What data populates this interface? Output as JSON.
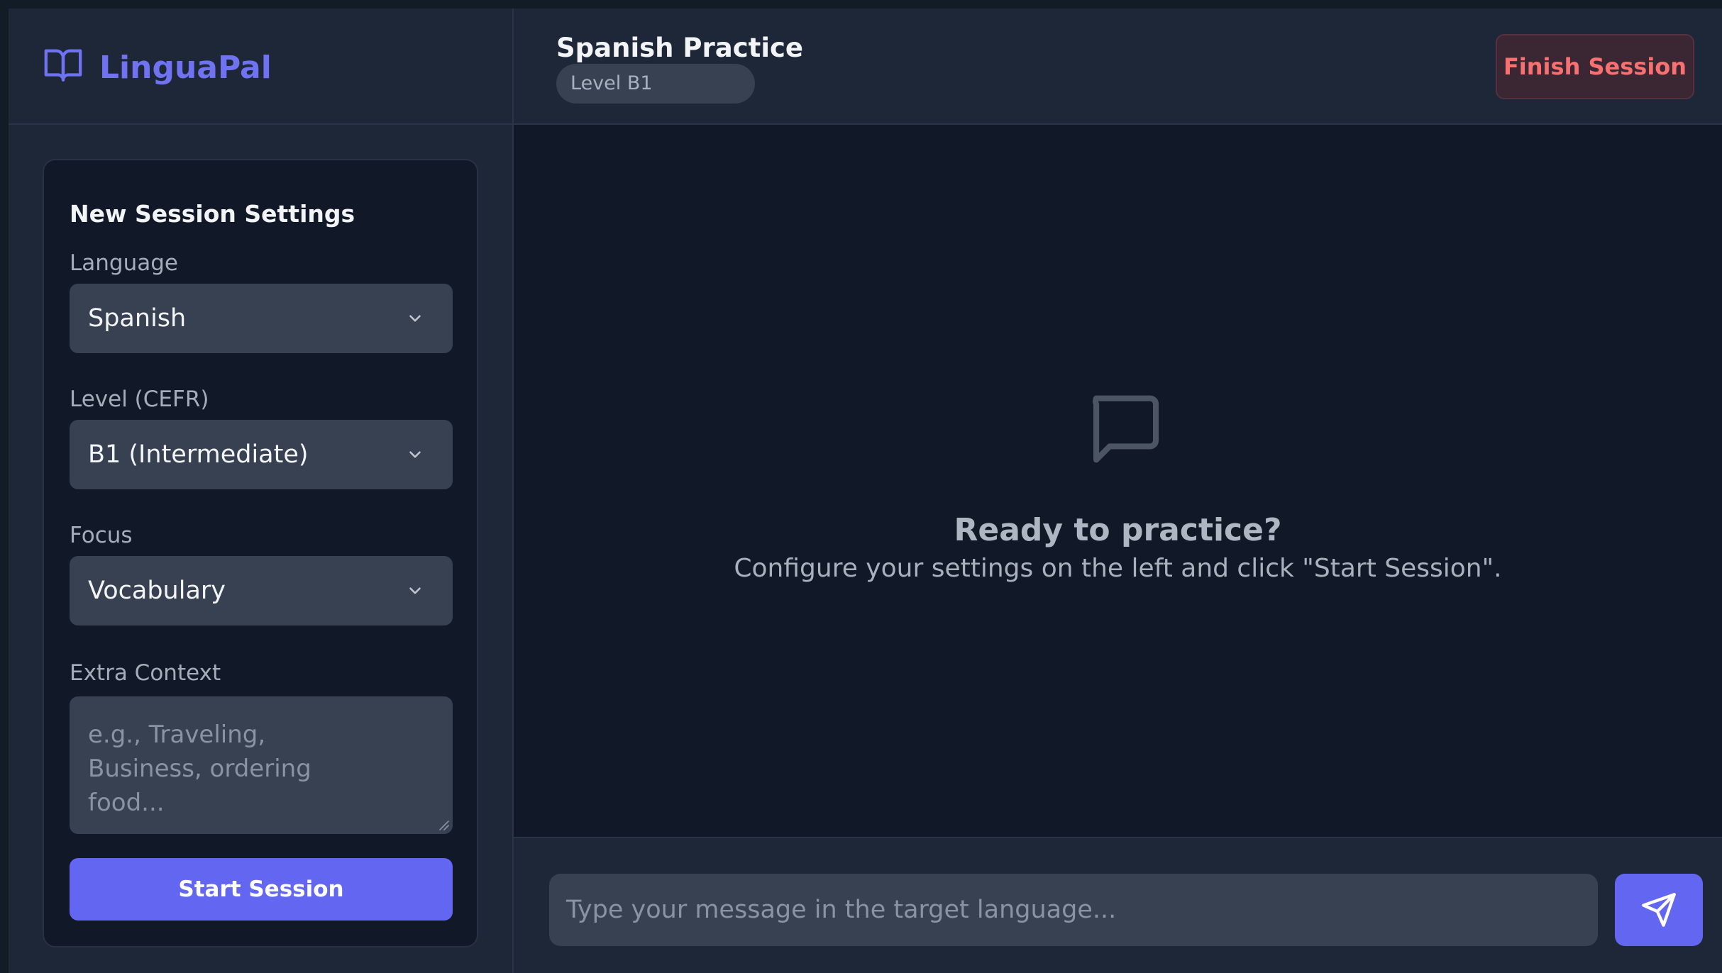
{
  "app": {
    "name": "LinguaPal",
    "accent_color": "#6366f1",
    "danger_color": "#f87171"
  },
  "icons": {
    "logo": "open-book-icon",
    "select": "chevron-down-icon",
    "empty_state": "message-square-icon",
    "send": "send-paper-plane-icon"
  },
  "sidebar": {
    "card_title": "New Session Settings",
    "language": {
      "label": "Language",
      "value": "Spanish"
    },
    "level": {
      "label": "Level (CEFR)",
      "value": "B1 (Intermediate)"
    },
    "focus": {
      "label": "Focus",
      "value": "Vocabulary"
    },
    "extra_context": {
      "label": "Extra Context",
      "placeholder": "e.g., Traveling, Business, ordering food..."
    },
    "start_button": "Start Session"
  },
  "header": {
    "title": "Spanish Practice",
    "level_badge": "Level B1",
    "finish_button": "Finish Session"
  },
  "chat": {
    "empty_title": "Ready to practice?",
    "empty_subtitle": "Configure your settings on the left and click \"Start Session\".",
    "input_placeholder": "Type your message in the target language..."
  }
}
